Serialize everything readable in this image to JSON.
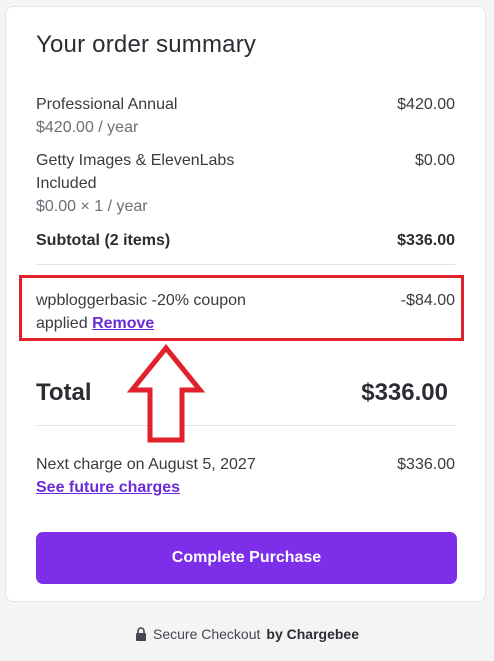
{
  "summary": {
    "title": "Your order summary",
    "items": [
      {
        "name": "Professional Annual",
        "meta": "$420.00 / year",
        "price": "$420.00"
      },
      {
        "name_line1": "Getty Images & ElevenLabs",
        "name_line2": "Included",
        "meta": "$0.00 × 1 / year",
        "price": "$0.00"
      }
    ],
    "subtotal_label": "Subtotal (2 items)",
    "subtotal_value": "$336.00",
    "coupon": {
      "line1": "wpbloggerbasic -20% coupon",
      "line2": "applied",
      "remove_label": "Remove",
      "value": "-$84.00"
    },
    "total_label": "Total",
    "total_value": "$336.00",
    "next_charge_label": "Next charge on August 5, 2027",
    "next_charge_value": "$336.00",
    "future_charges_link": "See future charges",
    "purchase_button": "Complete Purchase"
  },
  "footer": {
    "secure_text": "Secure Checkout",
    "by_text": "by Chargebee",
    "icon": "lock-icon"
  },
  "colors": {
    "accent": "#7c2ee8",
    "link": "#6b2bd9",
    "annotation": "#e0202a"
  }
}
